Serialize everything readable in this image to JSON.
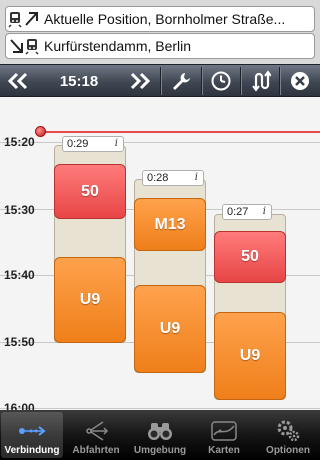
{
  "route": {
    "from": "Aktuelle Position, Bornholmer Straße...",
    "to": "Kurfürstendamm, Berlin"
  },
  "toolbar": {
    "prev_label": "«",
    "time": "15:18",
    "next_label": "»"
  },
  "timeline": {
    "labels": [
      "15:20",
      "15:30",
      "15:40",
      "15:50",
      "16:00"
    ],
    "now_color": "#e84a4a"
  },
  "connections": [
    {
      "duration": "0:29",
      "info": "i",
      "segments": [
        {
          "line": "50",
          "type": "bus",
          "color": "#e84545"
        },
        {
          "line": "U9",
          "type": "ubahn",
          "color": "#ef7f1a"
        }
      ]
    },
    {
      "duration": "0:28",
      "info": "i",
      "segments": [
        {
          "line": "M13",
          "type": "tram",
          "color": "#ef7f1a"
        },
        {
          "line": "U9",
          "type": "ubahn",
          "color": "#ef7f1a"
        }
      ]
    },
    {
      "duration": "0:27",
      "info": "i",
      "segments": [
        {
          "line": "50",
          "type": "bus",
          "color": "#e84545"
        },
        {
          "line": "U9",
          "type": "ubahn",
          "color": "#ef7f1a"
        }
      ]
    }
  ],
  "tabs": [
    {
      "label": "Verbindung",
      "icon": "connection-icon",
      "active": true
    },
    {
      "label": "Abfahrten",
      "icon": "departures-icon",
      "active": false
    },
    {
      "label": "Umgebung",
      "icon": "binoculars-icon",
      "active": false
    },
    {
      "label": "Karten",
      "icon": "map-icon",
      "active": false
    },
    {
      "label": "Optionen",
      "icon": "gears-icon",
      "active": false
    }
  ]
}
